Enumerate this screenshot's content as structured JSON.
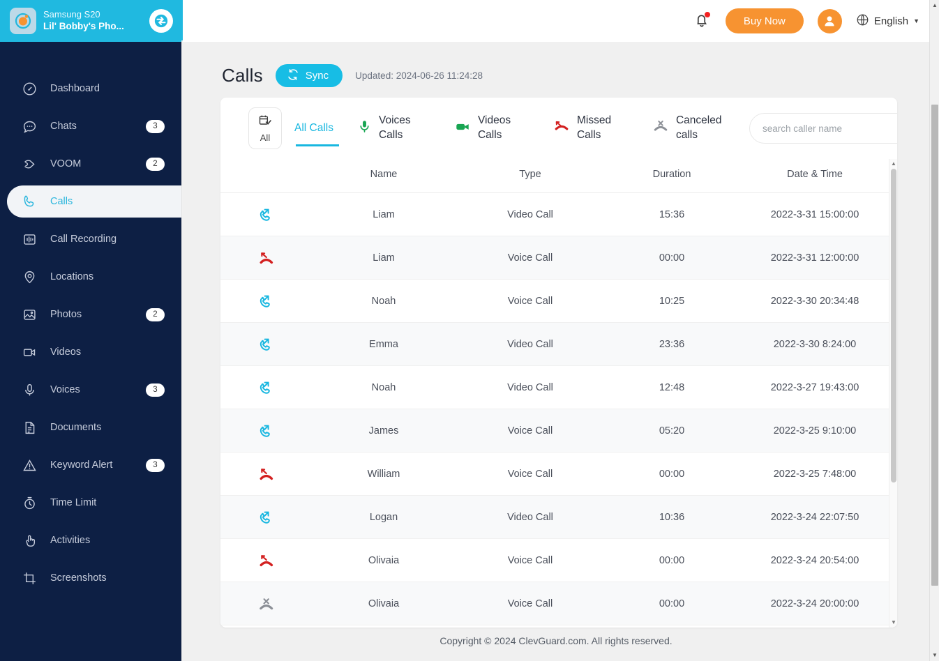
{
  "sidebar": {
    "device": {
      "model": "Samsung S20",
      "name": "Lil' Bobby's Pho...",
      "switch_icon": "switch-device-icon",
      "logo_icon": "clevguard-logo-icon"
    },
    "items": [
      {
        "label": "Dashboard",
        "icon": "dashboard-icon",
        "badge": "",
        "active": false
      },
      {
        "label": "Chats",
        "icon": "chat-bubble-icon",
        "badge": "3",
        "active": false
      },
      {
        "label": "VOOM",
        "icon": "voom-icon",
        "badge": "2",
        "active": false
      },
      {
        "label": "Calls",
        "icon": "phone-icon",
        "badge": "",
        "active": true
      },
      {
        "label": "Call Recording",
        "icon": "waveform-icon",
        "badge": "",
        "active": false
      },
      {
        "label": "Locations",
        "icon": "map-pin-icon",
        "badge": "",
        "active": false
      },
      {
        "label": "Photos",
        "icon": "photo-icon",
        "badge": "2",
        "active": false
      },
      {
        "label": "Videos",
        "icon": "video-camera-icon",
        "badge": "",
        "active": false
      },
      {
        "label": "Voices",
        "icon": "microphone-icon",
        "badge": "3",
        "active": false
      },
      {
        "label": "Documents",
        "icon": "document-icon",
        "badge": "",
        "active": false
      },
      {
        "label": "Keyword Alert",
        "icon": "warning-triangle-icon",
        "badge": "3",
        "active": false
      },
      {
        "label": "Time Limit",
        "icon": "stopwatch-icon",
        "badge": "",
        "active": false
      },
      {
        "label": "Activities",
        "icon": "hand-pointer-icon",
        "badge": "",
        "active": false
      },
      {
        "label": "Screenshots",
        "icon": "crop-icon",
        "badge": "",
        "active": false
      }
    ]
  },
  "topbar": {
    "notification_icon": "bell-icon",
    "has_notification": true,
    "buy_now_label": "Buy Now",
    "account_icon": "user-avatar-icon",
    "globe_icon": "globe-icon",
    "language": "English",
    "caret_icon": "chevron-down-icon"
  },
  "page": {
    "title": "Calls",
    "sync_label": "Sync",
    "sync_icon": "refresh-icon",
    "updated": "Updated: 2024-06-26 11:24:28"
  },
  "tabs": {
    "date_filter": {
      "label": "All",
      "icon": "calendar-check-icon"
    },
    "items": [
      {
        "label": "All Calls",
        "icon": "",
        "active": true
      },
      {
        "label": "Voices Calls",
        "icon": "microphone-icon",
        "active": false
      },
      {
        "label": "Videos Calls",
        "icon": "video-camera-icon",
        "active": false
      },
      {
        "label": "Missed Calls",
        "icon": "missed-call-icon",
        "active": false
      },
      {
        "label": "Canceled calls",
        "icon": "canceled-call-icon",
        "active": false
      }
    ],
    "search_placeholder": "search caller name",
    "search_value": ""
  },
  "table": {
    "columns": [
      "",
      "Name",
      "Type",
      "Duration",
      "Date & Time"
    ],
    "rows": [
      {
        "icon": "outgoing-call-icon",
        "name": "Liam",
        "type": "Video Call",
        "duration": "15:36",
        "datetime": "2022-3-31 15:00:00"
      },
      {
        "icon": "missed-call-icon",
        "name": "Liam",
        "type": "Voice Call",
        "duration": "00:00",
        "datetime": "2022-3-31 12:00:00"
      },
      {
        "icon": "outgoing-call-icon",
        "name": "Noah",
        "type": "Voice Call",
        "duration": "10:25",
        "datetime": "2022-3-30 20:34:48"
      },
      {
        "icon": "outgoing-call-icon",
        "name": "Emma",
        "type": "Video Call",
        "duration": "23:36",
        "datetime": "2022-3-30 8:24:00"
      },
      {
        "icon": "outgoing-call-icon",
        "name": "Noah",
        "type": "Video Call",
        "duration": "12:48",
        "datetime": "2022-3-27 19:43:00"
      },
      {
        "icon": "outgoing-call-icon",
        "name": "James",
        "type": "Voice Call",
        "duration": "05:20",
        "datetime": "2022-3-25 9:10:00"
      },
      {
        "icon": "missed-call-icon",
        "name": "William",
        "type": "Voice Call",
        "duration": "00:00",
        "datetime": "2022-3-25 7:48:00"
      },
      {
        "icon": "outgoing-call-icon",
        "name": "Logan",
        "type": "Video Call",
        "duration": "10:36",
        "datetime": "2022-3-24 22:07:50"
      },
      {
        "icon": "missed-call-icon",
        "name": "Olivaia",
        "type": "Voice Call",
        "duration": "00:00",
        "datetime": "2022-3-24 20:54:00"
      },
      {
        "icon": "canceled-call-icon",
        "name": "Olivaia",
        "type": "Voice Call",
        "duration": "00:00",
        "datetime": "2022-3-24 20:00:00"
      }
    ]
  },
  "footer": {
    "copyright": "Copyright © 2024 ClevGuard.com. All rights reserved."
  },
  "colors": {
    "sidebar_bg": "#0d1f44",
    "brand_cyan": "#20b9e0",
    "accent_orange": "#f79331",
    "missed_red": "#d32020",
    "outgoing_blue": "#18b7e0",
    "green": "#18a552"
  }
}
